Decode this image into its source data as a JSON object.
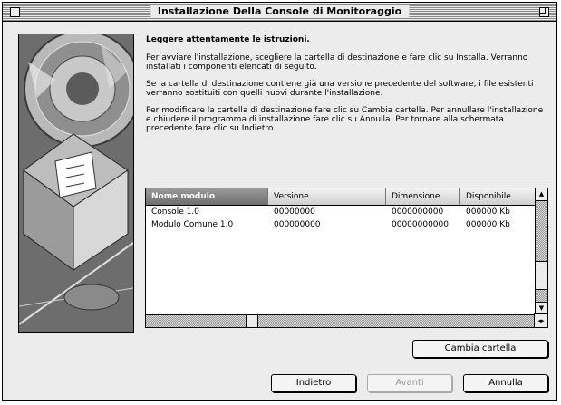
{
  "window": {
    "title": "Installazione Della Console di Monitoraggio"
  },
  "intro": {
    "heading": "Leggere attentamente le istruzioni.",
    "paragraph1": "Per avviare l'installazione, scegliere la cartella di destinazione e fare clic su Installa. Verranno installati i componenti elencati di seguito.",
    "paragraph2": "Se la cartella di destinazione contiene già una versione precedente del software, i file esistenti verranno sostituiti con quelli nuovi durante l'installazione.",
    "paragraph3": "Per modificare la cartella di destinazione fare clic su Cambia cartella. Per annullare l'installazione e chiudere il programma di installazione fare clic su Annulla. Per tornare alla schermata precedente fare clic su Indietro."
  },
  "table": {
    "columns": [
      "Nome modulo",
      "Versione",
      "Dimensione",
      "Disponibile"
    ],
    "rows": [
      [
        "Console 1.0",
        "00000000",
        "0000000000",
        "000000 Kb"
      ],
      [
        "Modulo Comune 1.0",
        "000000000",
        "00000000000",
        "000000 Kb"
      ]
    ]
  },
  "buttons": {
    "change_folder": "Cambia cartella",
    "back": "Indietro",
    "install": "Avanti",
    "cancel": "Annulla"
  },
  "icons": {
    "close_box": "close-box-icon",
    "zoom_box": "zoom-box-icon"
  }
}
